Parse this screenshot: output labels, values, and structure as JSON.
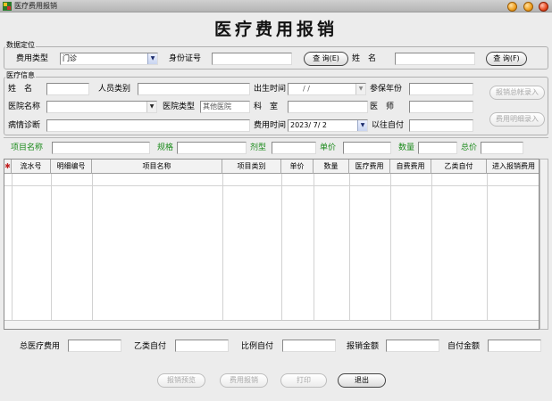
{
  "window": {
    "title": "医疗费用报销"
  },
  "page_title": "医疗费用报销",
  "query_section": {
    "legend": "数据定位",
    "fee_type_label": "费用类型",
    "fee_type_value": "门诊",
    "id_label": "身份证号",
    "id_value": "",
    "query_btn": "查 询(E)",
    "name_label": "姓　名",
    "name_value": "",
    "query_btn2": "查 询(F)"
  },
  "medical_section": {
    "legend": "医疗信息",
    "name_label": "姓　名",
    "name_value": "",
    "person_type_label": "人员类别",
    "person_type_value": "",
    "birth_label": "出生时间",
    "birth_value": "/ /",
    "ins_years_label": "参保年份",
    "ins_years_value": "",
    "hospital_label": "医院名称",
    "hospital_value": "",
    "hospital_type_label": "医院类型",
    "hospital_type_value": "其他医院",
    "dept_label": "科　室",
    "dept_value": "",
    "doctor_label": "医　师",
    "doctor_value": "",
    "diagnosis_label": "病情诊断",
    "diagnosis_value": "",
    "fee_time_label": "费用时间",
    "fee_time_value": "2023/ 7/ 2",
    "past_self_pay_label": "以往自付",
    "past_self_pay_value": "",
    "btn_total_entry": "报销总帐录入",
    "btn_detail_entry": "费用明细录入"
  },
  "item_bar": {
    "item_name_label": "项目名称",
    "spec_label": "规格",
    "dosage_label": "剂型",
    "price_label": "单价",
    "qty_label": "数量",
    "total_label": "总价"
  },
  "table": {
    "marker": "✱",
    "columns": [
      "流水号",
      "明细编号",
      "项目名称",
      "项目类别",
      "单价",
      "数量",
      "医疗费用",
      "自费费用",
      "乙类自付",
      "进入报销费用"
    ]
  },
  "summary": {
    "total_medical_label": "总医疗费用",
    "class_b_label": "乙类自付",
    "ratio_label": "比例自付",
    "reimb_amount_label": "报销金额",
    "self_amount_label": "自付金额"
  },
  "footer_buttons": {
    "preview": "报销预览",
    "fee_reimb": "费用报销",
    "print": "打印",
    "exit": "退出"
  },
  "colors": {
    "accent_green": "#1a8a1a",
    "window_bg": "#ececec"
  }
}
